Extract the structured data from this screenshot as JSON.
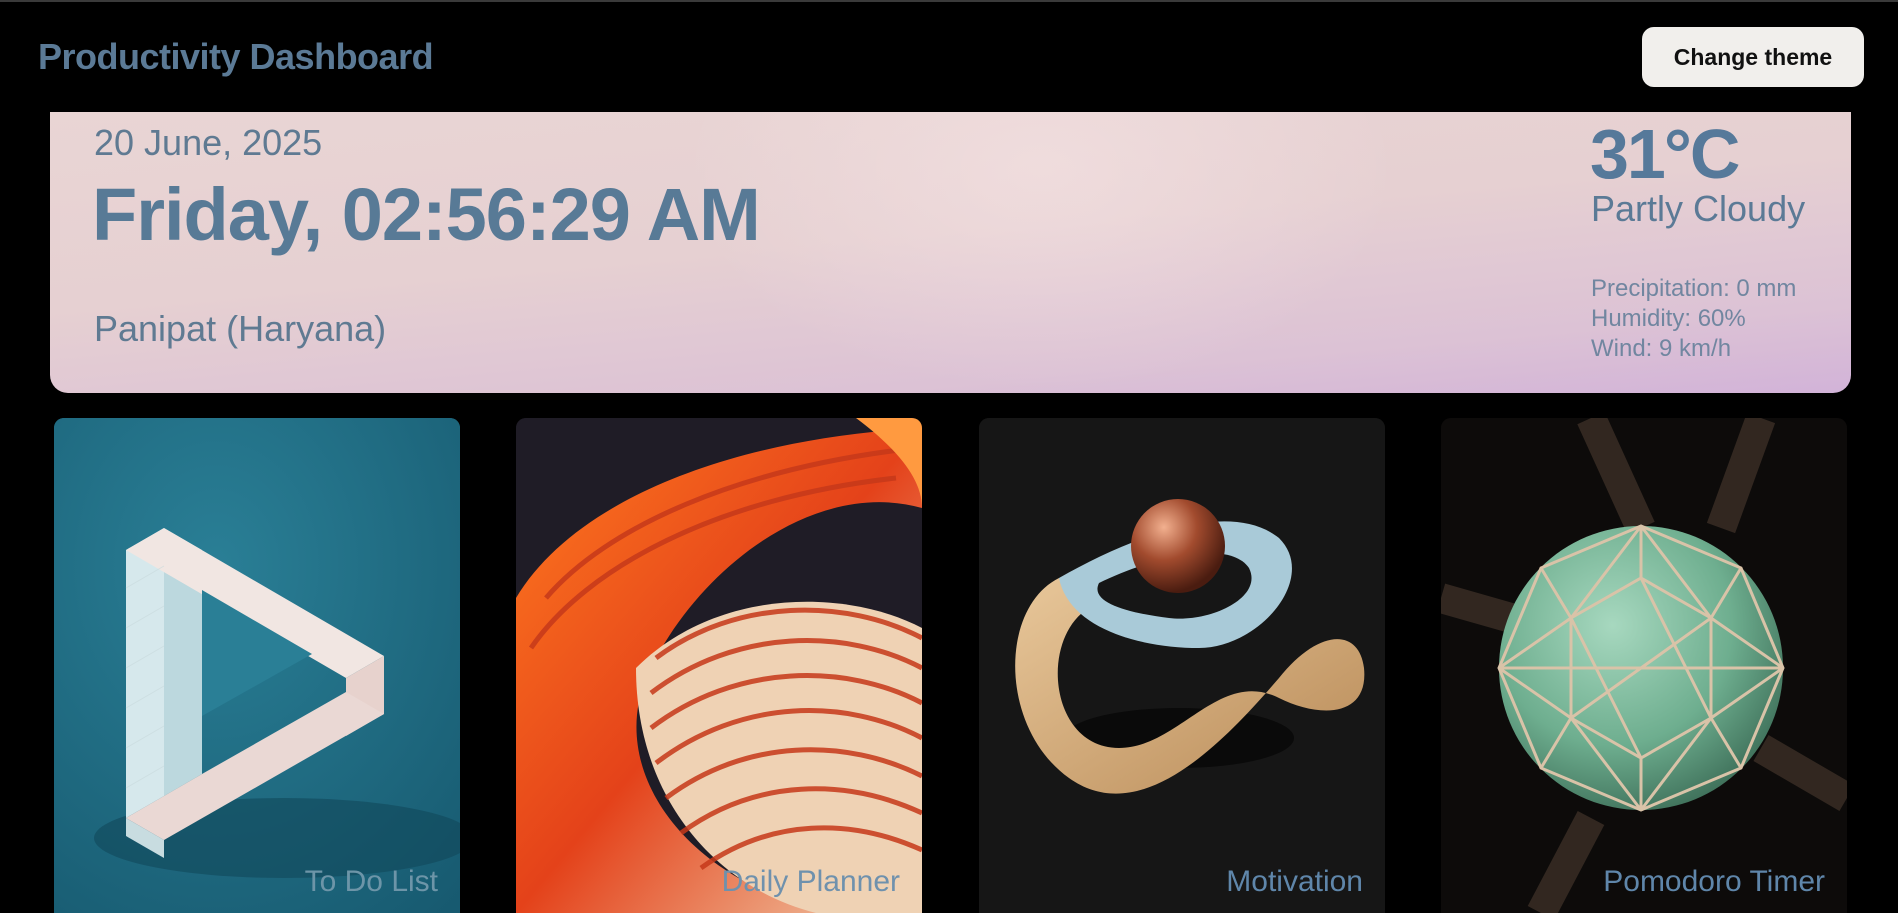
{
  "header": {
    "title": "Productivity Dashboard",
    "theme_button": "Change theme"
  },
  "hero": {
    "date": "20 June, 2025",
    "day_time": "Friday, 02:56:29 AM",
    "location": "Panipat (Haryana)"
  },
  "weather": {
    "temperature": "31°C",
    "condition": "Partly Cloudy",
    "precipitation": "Precipitation: 0 mm",
    "humidity": "Humidity: 60%",
    "wind": "Wind: 9 km/h"
  },
  "cards": [
    {
      "label": "To Do List",
      "image": "impossible-triangle-image"
    },
    {
      "label": "Daily Planner",
      "image": "orange-spiral-image"
    },
    {
      "label": "Motivation",
      "image": "twisted-ring-sphere-image"
    },
    {
      "label": "Pomodoro Timer",
      "image": "geodesic-sphere-image"
    }
  ],
  "colors": {
    "title_blue": "#5b7a96",
    "hero_gradient_top": "#e9d5d4",
    "hero_gradient_bottom": "#d2b3d8",
    "background": "#000000"
  }
}
